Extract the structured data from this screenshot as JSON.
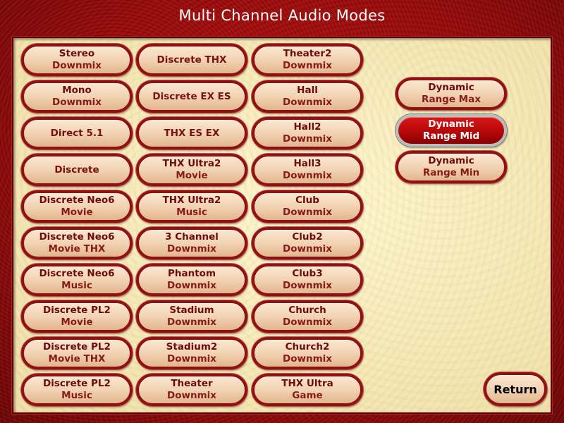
{
  "title": "Multi Channel Audio Modes",
  "columns": [
    [
      {
        "l1": "Stereo",
        "l2": "Downmix"
      },
      {
        "l1": "Mono",
        "l2": "Downmix"
      },
      {
        "l1": "Direct 5.1",
        "l2": ""
      },
      {
        "l1": "Discrete",
        "l2": ""
      },
      {
        "l1": "Discrete Neo6",
        "l2": "Movie"
      },
      {
        "l1": "Discrete Neo6",
        "l2": "Movie THX"
      },
      {
        "l1": "Discrete Neo6",
        "l2": "Music"
      },
      {
        "l1": "Discrete PL2",
        "l2": "Movie"
      },
      {
        "l1": "Discrete PL2",
        "l2": "Movie THX"
      },
      {
        "l1": "Discrete PL2",
        "l2": "Music"
      }
    ],
    [
      {
        "l1": "Discrete THX",
        "l2": ""
      },
      {
        "l1": "Discrete EX ES",
        "l2": ""
      },
      {
        "l1": "THX ES EX",
        "l2": ""
      },
      {
        "l1": "THX Ultra2",
        "l2": "Movie"
      },
      {
        "l1": "THX Ultra2",
        "l2": "Music"
      },
      {
        "l1": "3 Channel",
        "l2": "Downmix"
      },
      {
        "l1": "Phantom",
        "l2": "Downmix"
      },
      {
        "l1": "Stadium",
        "l2": "Downmix"
      },
      {
        "l1": "Stadium2",
        "l2": "Downmix"
      },
      {
        "l1": "Theater",
        "l2": "Downmix"
      }
    ],
    [
      {
        "l1": "Theater2",
        "l2": "Downmix"
      },
      {
        "l1": "Hall",
        "l2": "Downmix"
      },
      {
        "l1": "Hall2",
        "l2": "Downmix"
      },
      {
        "l1": "Hall3",
        "l2": "Downmix"
      },
      {
        "l1": "Club",
        "l2": "Downmix"
      },
      {
        "l1": "Club2",
        "l2": "Downmix"
      },
      {
        "l1": "Club3",
        "l2": "Downmix"
      },
      {
        "l1": "Church",
        "l2": "Downmix"
      },
      {
        "l1": "Church2",
        "l2": "Downmix"
      },
      {
        "l1": "THX Ultra",
        "l2": "Game"
      }
    ]
  ],
  "dynamic_range": [
    {
      "l1": "Dynamic",
      "l2": "Range Max",
      "selected": false
    },
    {
      "l1": "Dynamic",
      "l2": "Range Mid",
      "selected": true
    },
    {
      "l1": "Dynamic",
      "l2": "Range Min",
      "selected": false
    }
  ],
  "return_label": "Return",
  "colors": {
    "frame_red": "#a80c0c",
    "panel_cream": "#f7ecbd",
    "button_fill": "#f2d3b3",
    "button_border": "#8e1212",
    "button_text": "#7a1010",
    "active_fill": "#c00a0a",
    "active_text": "#ffffff"
  }
}
